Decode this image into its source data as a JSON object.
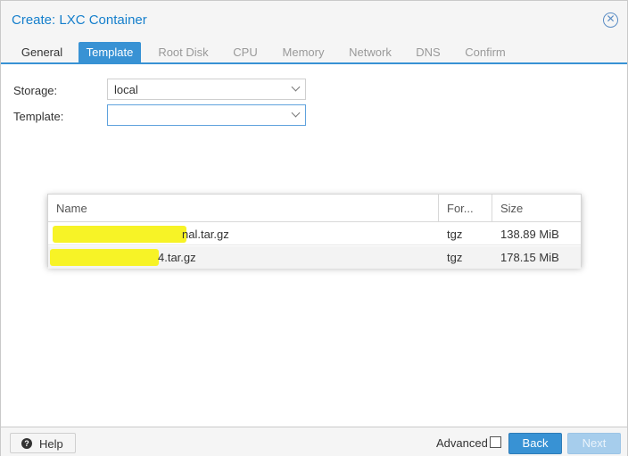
{
  "window": {
    "title": "Create: LXC Container"
  },
  "tabs": [
    {
      "label": "General"
    },
    {
      "label": "Template"
    },
    {
      "label": "Root Disk"
    },
    {
      "label": "CPU"
    },
    {
      "label": "Memory"
    },
    {
      "label": "Network"
    },
    {
      "label": "DNS"
    },
    {
      "label": "Confirm"
    }
  ],
  "form": {
    "storage_label": "Storage:",
    "storage_value": "local",
    "template_label": "Template:",
    "template_value": ""
  },
  "picker": {
    "columns": [
      "Name",
      "For...",
      "Size"
    ],
    "rows": [
      {
        "name": "nal.tar.gz",
        "format": "tgz",
        "size": "138.89 MiB"
      },
      {
        "name": "4.tar.gz",
        "format": "tgz",
        "size": "178.15 MiB"
      }
    ]
  },
  "footer": {
    "help_label": "Help",
    "advanced_label": "Advanced",
    "advanced_checked": false,
    "back_label": "Back",
    "next_label": "Next"
  },
  "colors": {
    "accent": "#3892d4",
    "title": "#157fcc",
    "redaction": "#f7f21a"
  }
}
